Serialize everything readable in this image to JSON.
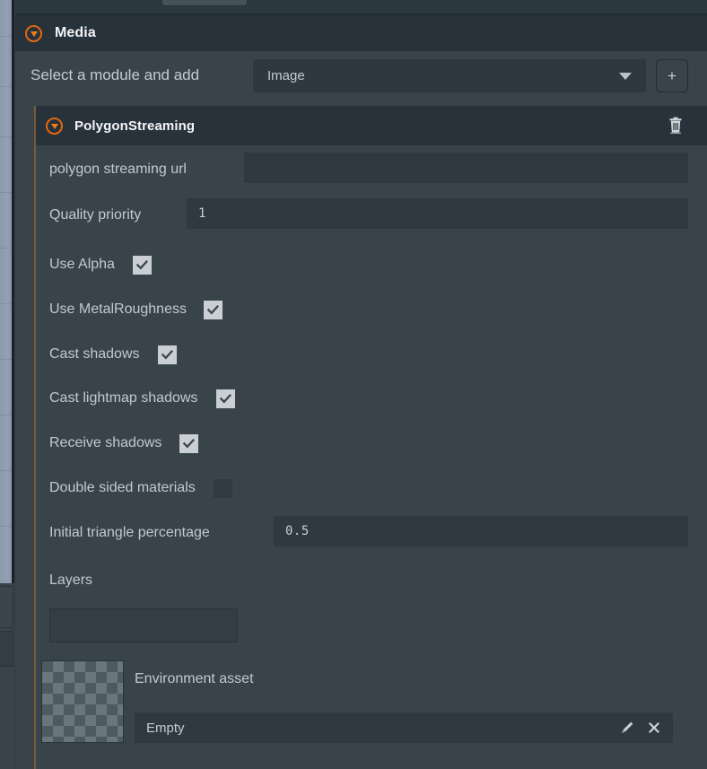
{
  "section": {
    "title": "Media",
    "collapse_icon": "chevron-down-circle-icon"
  },
  "module_picker": {
    "label": "Select a module and add",
    "selected": "Image",
    "caret_icon": "chevron-down-icon",
    "add_label": "+"
  },
  "module": {
    "name": "PolygonStreaming",
    "collapse_icon": "chevron-down-circle-icon",
    "delete_icon": "trash-icon",
    "accent_color": "#e2690f",
    "properties": [
      {
        "label": "polygon streaming url",
        "type": "text",
        "value": ""
      },
      {
        "label": "Quality priority",
        "type": "text",
        "value": "1"
      },
      {
        "label": "Use Alpha",
        "type": "checkbox",
        "checked": true
      },
      {
        "label": "Use MetalRoughness",
        "type": "checkbox",
        "checked": true
      },
      {
        "label": "Cast shadows",
        "type": "checkbox",
        "checked": true
      },
      {
        "label": "Cast lightmap shadows",
        "type": "checkbox",
        "checked": true
      },
      {
        "label": "Receive shadows",
        "type": "checkbox",
        "checked": true
      },
      {
        "label": "Double sided materials",
        "type": "checkbox",
        "checked": false
      },
      {
        "label": "Initial triangle percentage",
        "type": "text",
        "value": "0.5"
      },
      {
        "label": "Layers",
        "type": "list",
        "value": ""
      }
    ],
    "asset": {
      "label": "Environment asset",
      "value": "Empty",
      "thumbnail": "transparent-checkerboard-thumbnail",
      "edit_icon": "pencil-icon",
      "clear_icon": "close-icon"
    }
  }
}
